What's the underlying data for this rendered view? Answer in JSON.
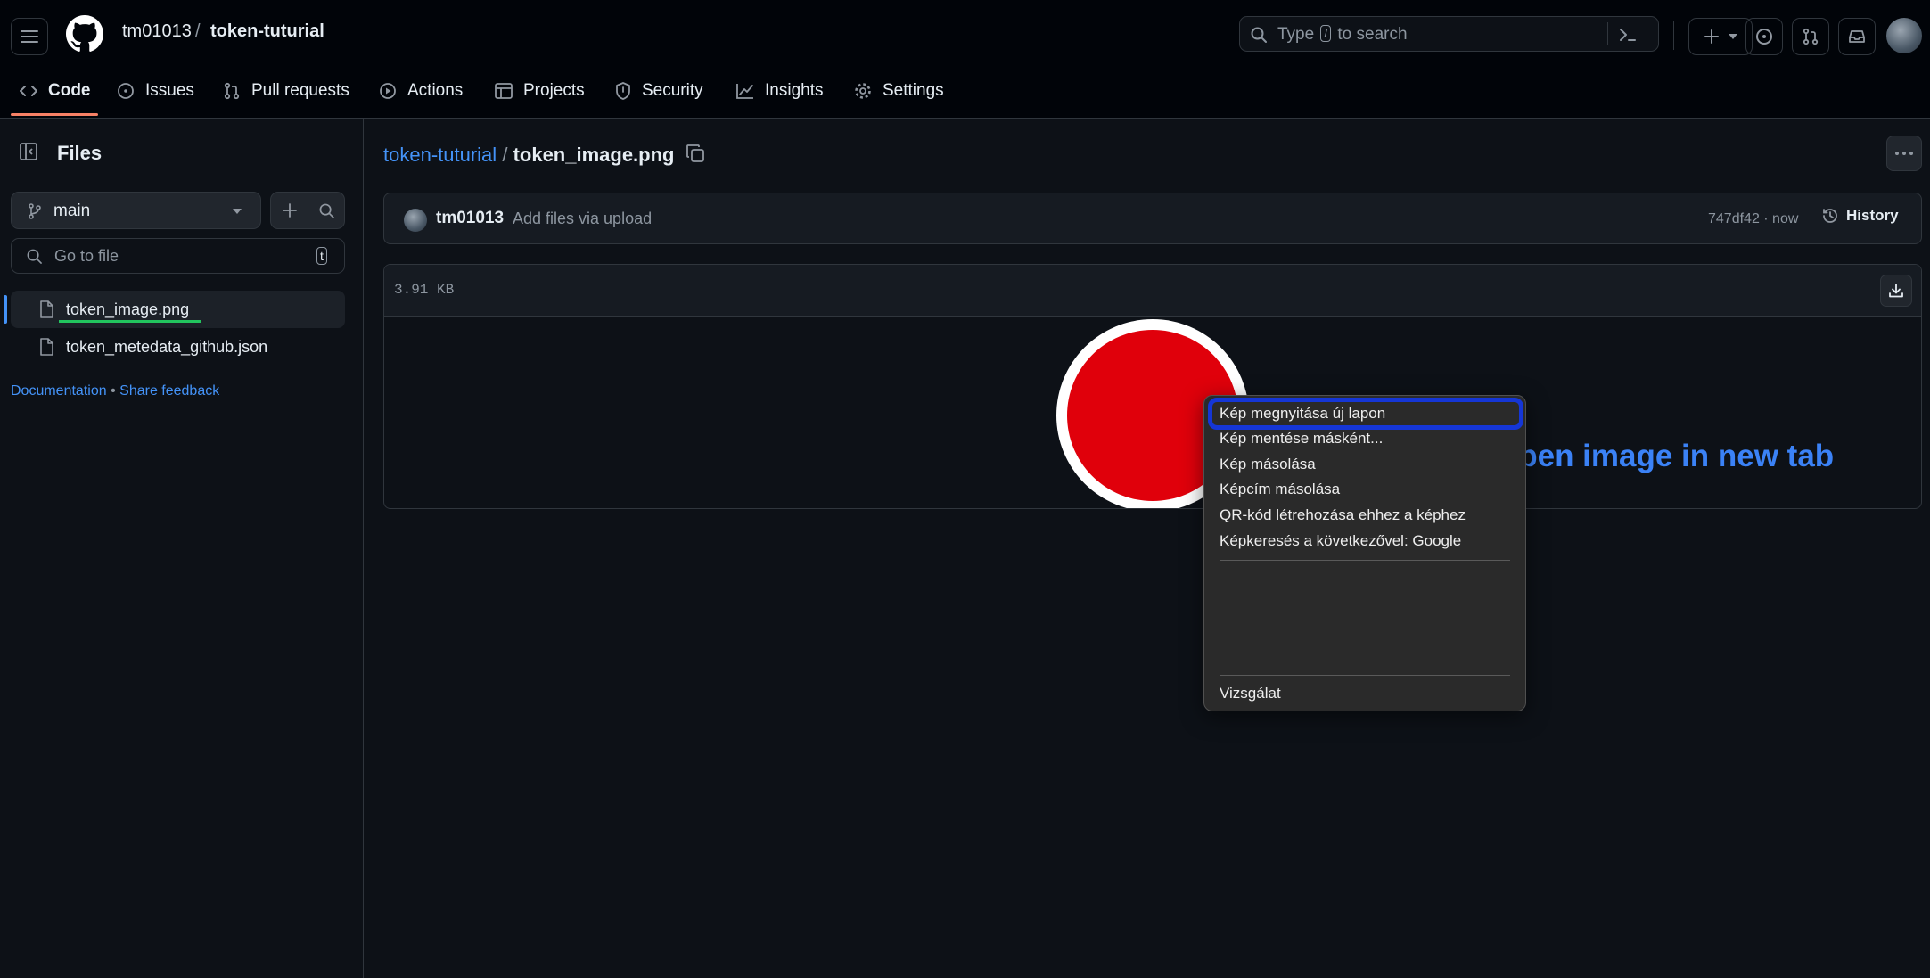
{
  "header": {
    "owner": "tm01013",
    "separator": "/",
    "repo": "token-tuturial",
    "search_before": "Type",
    "search_key": "/",
    "search_after": "to search"
  },
  "tabs": [
    {
      "label": "Code",
      "icon": "code-icon"
    },
    {
      "label": "Issues",
      "icon": "issue-icon"
    },
    {
      "label": "Pull requests",
      "icon": "pull-request-icon"
    },
    {
      "label": "Actions",
      "icon": "play-icon"
    },
    {
      "label": "Projects",
      "icon": "table-icon"
    },
    {
      "label": "Security",
      "icon": "shield-icon"
    },
    {
      "label": "Insights",
      "icon": "graph-icon"
    },
    {
      "label": "Settings",
      "icon": "gear-icon"
    }
  ],
  "sidebar": {
    "title": "Files",
    "branch": "main",
    "goto_placeholder": "Go to file",
    "goto_key": "t",
    "files": [
      "token_image.png",
      "token_metedata_github.json"
    ],
    "documentation": "Documentation",
    "bullet": "•",
    "share_feedback": "Share feedback"
  },
  "main": {
    "breadcrumb_repo": "token-tuturial",
    "breadcrumb_sep": "/",
    "filename": "token_image.png",
    "commit_author": "tm01013",
    "commit_message": "Add files via upload",
    "commit_meta": "747df42 · now",
    "history_label": "History",
    "file_size": "3.91 KB"
  },
  "context_menu": {
    "items": [
      "Kép megnyitása új lapon",
      "Kép mentése másként...",
      "Kép másolása",
      "Képcím másolása",
      "QR-kód létrehozása ehhez a képhez",
      "Képkeresés a következővel: Google"
    ],
    "inspect": "Vizsgálat"
  },
  "annotation": "Open image in new tab",
  "colors": {
    "accent_link": "#4493f8",
    "active_tab_underline": "#f78166",
    "token_red": "#e0000b",
    "highlight_border": "#1536d6",
    "annotation_text": "#3b82f6",
    "underline_green": "#22c55e"
  }
}
